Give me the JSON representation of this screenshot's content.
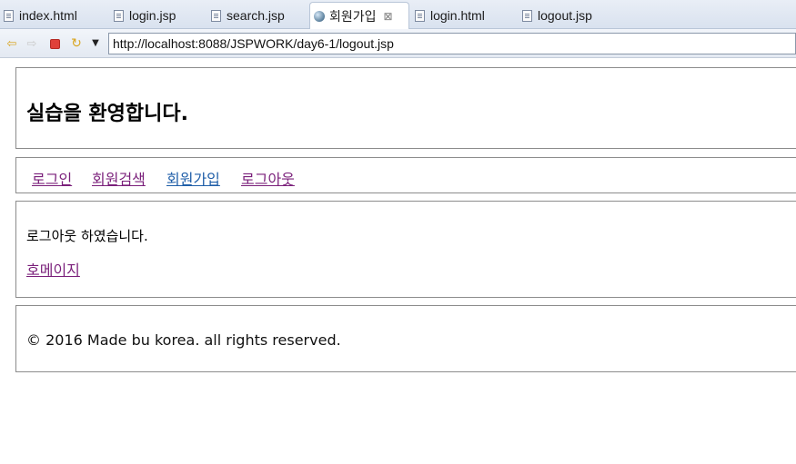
{
  "tabs": [
    {
      "label": "index.html",
      "icon": "file-icon"
    },
    {
      "label": "login.jsp",
      "icon": "file-icon"
    },
    {
      "label": "search.jsp",
      "icon": "file-icon"
    },
    {
      "label": "회원가입",
      "icon": "globe-icon",
      "active": true,
      "close": "⊠"
    },
    {
      "label": "login.html",
      "icon": "file-icon"
    },
    {
      "label": "logout.jsp",
      "icon": "file-icon"
    }
  ],
  "toolbar": {
    "back_icon": "⇦",
    "forward_icon": "⇨",
    "refresh_icon": "↻",
    "dropdown_icon": "▼",
    "url": "http://localhost:8088/JSPWORK/day6-1/logout.jsp"
  },
  "page": {
    "title": "실습을 환영합니다.",
    "nav": [
      {
        "label": "로그인"
      },
      {
        "label": "회원검색"
      },
      {
        "label": "회원가입"
      },
      {
        "label": "로그아웃"
      }
    ],
    "message": "로그아웃 하였습니다.",
    "home_link": "호메이지",
    "footer": "© 2016 Made bu korea. all rights reserved."
  },
  "colors": {
    "visited_link": "#7a1f7a",
    "link": "#1f5ea8",
    "stop": "#e0413a"
  }
}
